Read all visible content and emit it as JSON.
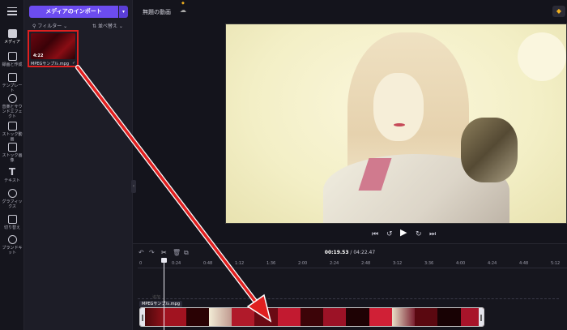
{
  "sidebar": {
    "items": [
      {
        "label": "メディア",
        "icon": "folder-icon"
      },
      {
        "label": "録画と作成",
        "icon": "camera-icon"
      },
      {
        "label": "テンプレート",
        "icon": "template-icon"
      },
      {
        "label": "音楽とサウンドエフェクト",
        "icon": "music-note-icon"
      },
      {
        "label": "ストック動画",
        "icon": "stock-video-icon"
      },
      {
        "label": "ストック画像",
        "icon": "stock-image-icon"
      },
      {
        "label": "テキスト",
        "icon": "text-icon"
      },
      {
        "label": "グラフィックス",
        "icon": "shapes-icon"
      },
      {
        "label": "切り替え",
        "icon": "transition-icon"
      },
      {
        "label": "ブランドキット",
        "icon": "brand-kit-icon"
      }
    ]
  },
  "media_panel": {
    "import_label": "メディアのインポート",
    "filter_label": "フィルター",
    "sort_label": "並べ替え",
    "asset": {
      "duration": "4:22",
      "filename": "MPEGサンプル.mpg"
    }
  },
  "topbar": {
    "title": "無題の動画"
  },
  "player": {
    "current_time": "00:19.53",
    "total_time": "04:22.47"
  },
  "timeline": {
    "ruler": [
      "0",
      "0:24",
      "0:48",
      "1:12",
      "1:36",
      "2:00",
      "2:24",
      "2:48",
      "3:12",
      "3:36",
      "4:00",
      "4:24",
      "4:48",
      "5:12"
    ],
    "add_text_hint": "追加",
    "clip_label": "MPEGサンプル.mpg"
  },
  "colors": {
    "accent": "#6c4cf0",
    "highlight_box": "#e02020",
    "arrow": "#e02020"
  }
}
